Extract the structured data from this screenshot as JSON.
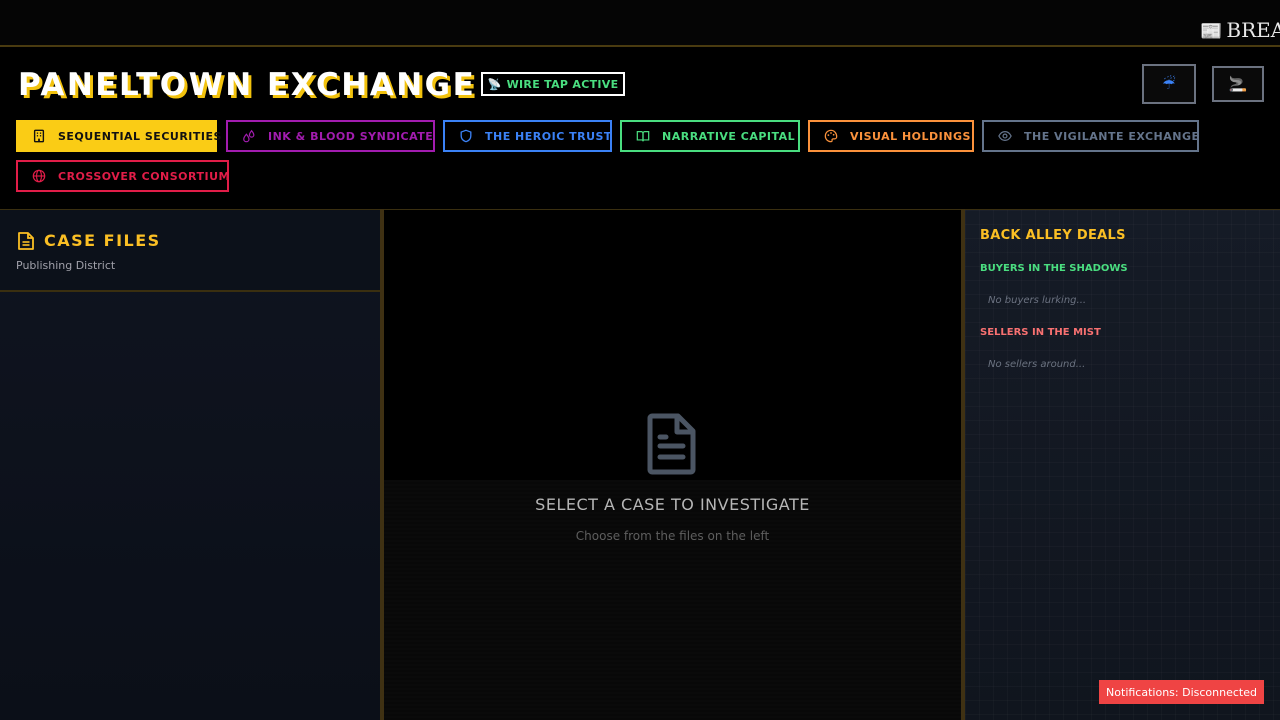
{
  "ticker": {
    "icon": "newspaper-icon",
    "text": "BREA"
  },
  "header": {
    "title": "PANELTOWN EXCHANGE",
    "wiretap": {
      "icon": "satellite-antenna-icon",
      "label": "WIRE TAP ACTIVE"
    },
    "buttons": [
      {
        "icon": "umbrella-rain-icon"
      },
      {
        "icon": "cigarette-icon"
      }
    ]
  },
  "publishers": [
    {
      "label": "SEQUENTIAL SECURITIES",
      "icon": "building-icon",
      "color": "#facc15",
      "active": true
    },
    {
      "label": "INK & BLOOD SYNDICATE",
      "icon": "droplets-icon",
      "color": "#a21caf",
      "active": false
    },
    {
      "label": "THE HEROIC TRUST",
      "icon": "shield-icon",
      "color": "#3b82f6",
      "active": false
    },
    {
      "label": "NARRATIVE CAPITAL",
      "icon": "book-open-icon",
      "color": "#4ade80",
      "active": false
    },
    {
      "label": "VISUAL HOLDINGS",
      "icon": "palette-icon",
      "color": "#fb923c",
      "active": false
    },
    {
      "label": "THE VIGILANTE EXCHANGE",
      "icon": "eye-icon",
      "color": "#64748b",
      "active": false
    },
    {
      "label": "CROSSOVER CONSORTIUM",
      "icon": "globe-icon",
      "color": "#e11d48",
      "active": false
    }
  ],
  "case_files": {
    "title": "CASE FILES",
    "subtitle": "Publishing District"
  },
  "main": {
    "empty_title": "SELECT A CASE TO INVESTIGATE",
    "empty_subtitle": "Choose from the files on the left"
  },
  "deals": {
    "title": "BACK ALLEY DEALS",
    "buyers_title": "BUYERS IN THE SHADOWS",
    "buyers_empty": "No buyers lurking...",
    "sellers_title": "SELLERS IN THE MIST",
    "sellers_empty": "No sellers around..."
  },
  "notification": "Notifications: Disconnected"
}
